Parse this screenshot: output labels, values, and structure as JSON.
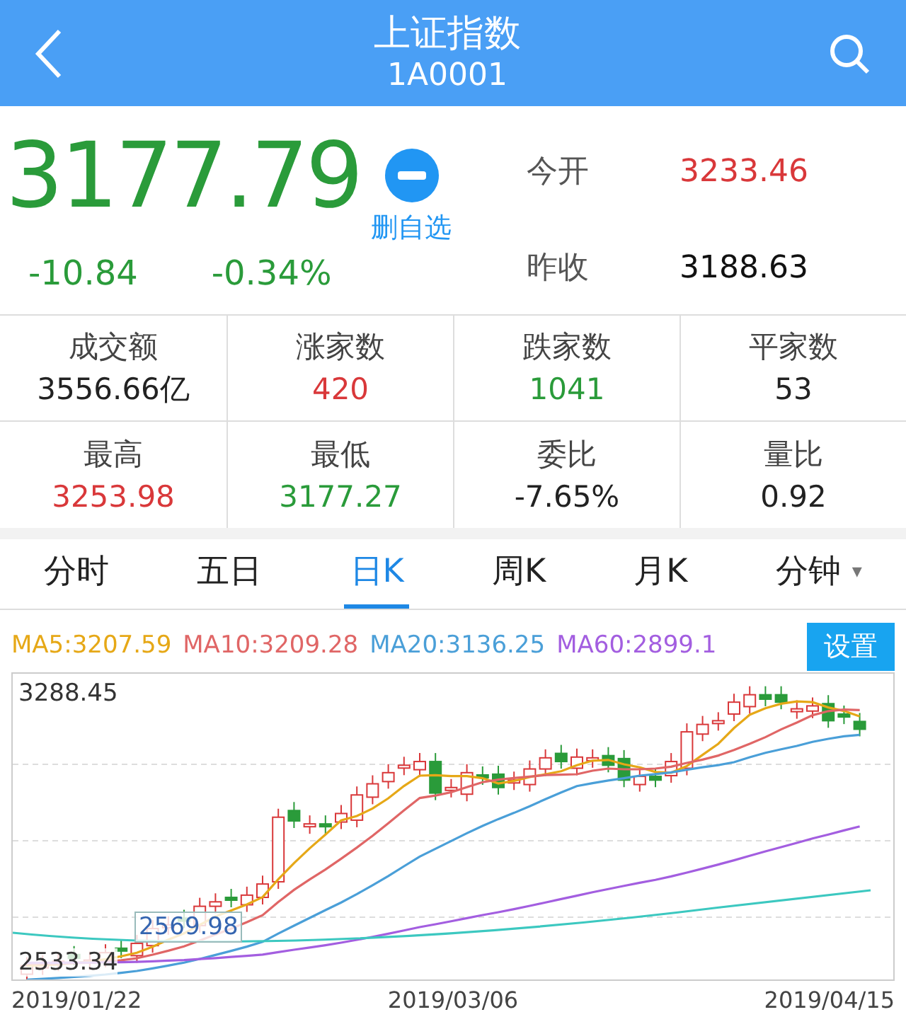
{
  "header": {
    "title": "上证指数",
    "code": "1A0001"
  },
  "quote": {
    "price": "3177.79",
    "change": "-10.84",
    "change_pct": "-0.34%",
    "watch_action": "删自选",
    "open_label": "今开",
    "open_value": "3233.46",
    "prev_close_label": "昨收",
    "prev_close_value": "3188.63"
  },
  "stats": [
    {
      "label": "成交额",
      "value": "3556.66亿",
      "color": "#222222"
    },
    {
      "label": "涨家数",
      "value": "420",
      "color": "#d9383a"
    },
    {
      "label": "跌家数",
      "value": "1041",
      "color": "#2a9b3a"
    },
    {
      "label": "平家数",
      "value": "53",
      "color": "#222222"
    },
    {
      "label": "最高",
      "value": "3253.98",
      "color": "#d9383a"
    },
    {
      "label": "最低",
      "value": "3177.27",
      "color": "#2a9b3a"
    },
    {
      "label": "委比",
      "value": "-7.65%",
      "color": "#222222"
    },
    {
      "label": "量比",
      "value": "0.92",
      "color": "#222222"
    }
  ],
  "tabs": [
    {
      "label": "分时",
      "selected": false
    },
    {
      "label": "五日",
      "selected": false
    },
    {
      "label": "日K",
      "selected": true
    },
    {
      "label": "周K",
      "selected": false
    },
    {
      "label": "月K",
      "selected": false
    },
    {
      "label": "分钟",
      "selected": false,
      "dropdown": "▾"
    }
  ],
  "legend": [
    {
      "text": "MA5:3207.59",
      "color": "#e6a817"
    },
    {
      "text": "MA10:3209.28",
      "color": "#e06666"
    },
    {
      "text": "MA20:3136.25",
      "color": "#4a9fd8"
    },
    {
      "text": "MA60:2899.1",
      "color": "#a35ee0"
    }
  ],
  "settings_button": "设置",
  "chart": {
    "high_label": "3288.45",
    "low_label": "2533.34",
    "marker_label": "2569.98",
    "dates": [
      "2019/01/22",
      "2019/03/06",
      "2019/04/15"
    ]
  }
}
